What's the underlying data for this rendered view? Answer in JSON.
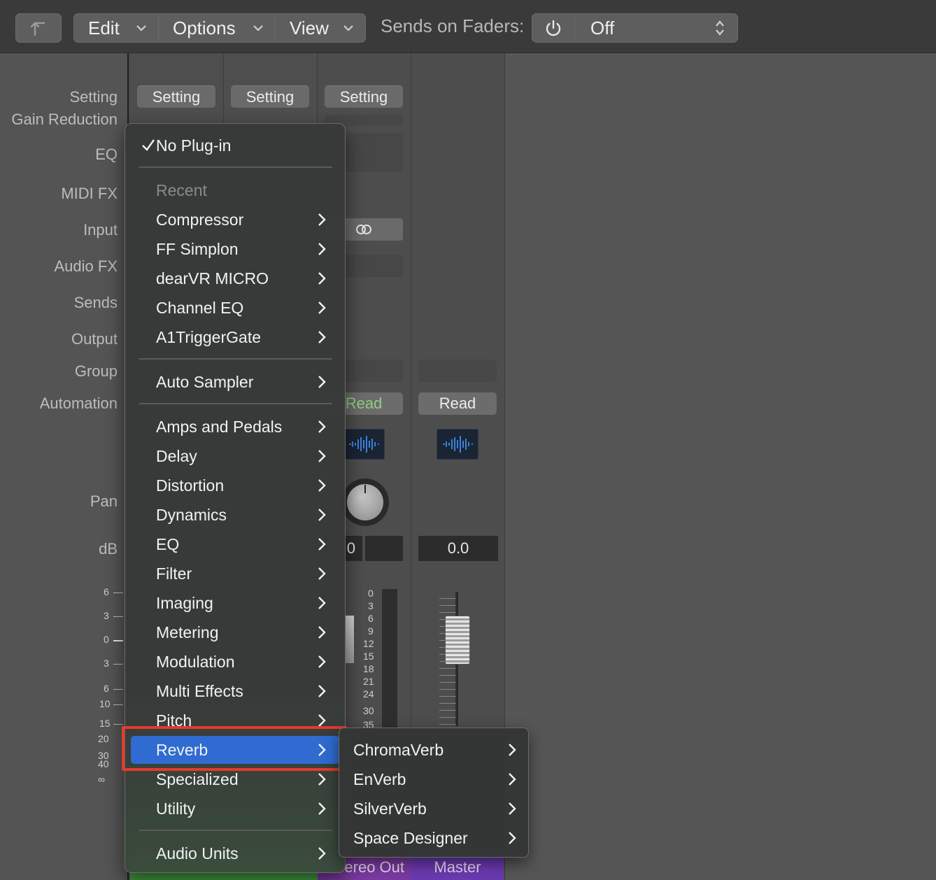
{
  "toolbar": {
    "edit_label": "Edit",
    "options_label": "Options",
    "view_label": "View",
    "sends_on_faders_label": "Sends on Faders:",
    "sends_on_faders_value": "Off"
  },
  "row_labels": {
    "setting": "Setting",
    "gain_reduction": "Gain Reduction",
    "eq": "EQ",
    "midi_fx": "MIDI FX",
    "input": "Input",
    "audio_fx": "Audio FX",
    "sends": "Sends",
    "output": "Output",
    "group": "Group",
    "automation": "Automation",
    "pan": "Pan",
    "db": "dB"
  },
  "strips": {
    "setting_labels": [
      "Setting",
      "Setting",
      "Setting"
    ],
    "read_labels": [
      "Read",
      "Read"
    ],
    "db_values": [
      "0",
      "0.0"
    ],
    "names": [
      "ereo Out",
      "Master"
    ]
  },
  "left_scale": [
    "6",
    "3",
    "0",
    "3",
    "6",
    "10",
    "15",
    "20",
    "30",
    "40",
    "∞"
  ],
  "strip_scale": [
    "0",
    "3",
    "6",
    "9",
    "12",
    "15",
    "18",
    "21",
    "24",
    "30",
    "35"
  ],
  "menu": {
    "no_plugin": "No Plug-in",
    "recent_header": "Recent",
    "recent": [
      "Compressor",
      "FF Simplon",
      "dearVR MICRO",
      "Channel EQ",
      "A1TriggerGate"
    ],
    "auto_sampler": "Auto Sampler",
    "categories": [
      "Amps and Pedals",
      "Delay",
      "Distortion",
      "Dynamics",
      "EQ",
      "Filter",
      "Imaging",
      "Metering",
      "Modulation",
      "Multi Effects",
      "Pitch",
      "Reverb",
      "Specialized",
      "Utility"
    ],
    "audio_units": "Audio Units",
    "highlighted": "Reverb"
  },
  "submenu": {
    "items": [
      "ChromaVerb",
      "EnVerb",
      "SilverVerb",
      "Space Designer"
    ]
  },
  "colors": {
    "highlight": "#2f6bd1",
    "annotation_border": "#e43a2a",
    "read_green": "#8fd07a",
    "stereo_out_bar": "#7a3aa0",
    "master_bar": "#6a3ab0",
    "waveform": "#3d8cf0"
  }
}
